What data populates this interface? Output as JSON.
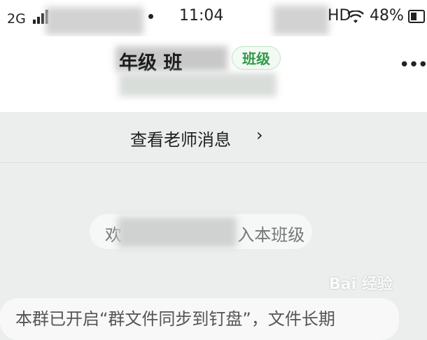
{
  "status_bar": {
    "network": "2G",
    "time": "11:04",
    "hd": "HD",
    "battery": "48%",
    "battery_level": 0.48
  },
  "header": {
    "title_visible": "年级 班",
    "badge": "班级",
    "more_icon": "more-dots-icon"
  },
  "teacher_link": {
    "label": "查看老师消息",
    "chevron": "›"
  },
  "system_message": {
    "text_start": "欢",
    "text_end": "入本班级"
  },
  "notice": {
    "text": "本群已开启“群文件同步到钉盘”，文件长期"
  },
  "watermark": {
    "text": "Bai 经验"
  },
  "colors": {
    "accent_green": "#2f9a48",
    "badge_border": "#bfe3c6",
    "background": "#eceeed"
  }
}
